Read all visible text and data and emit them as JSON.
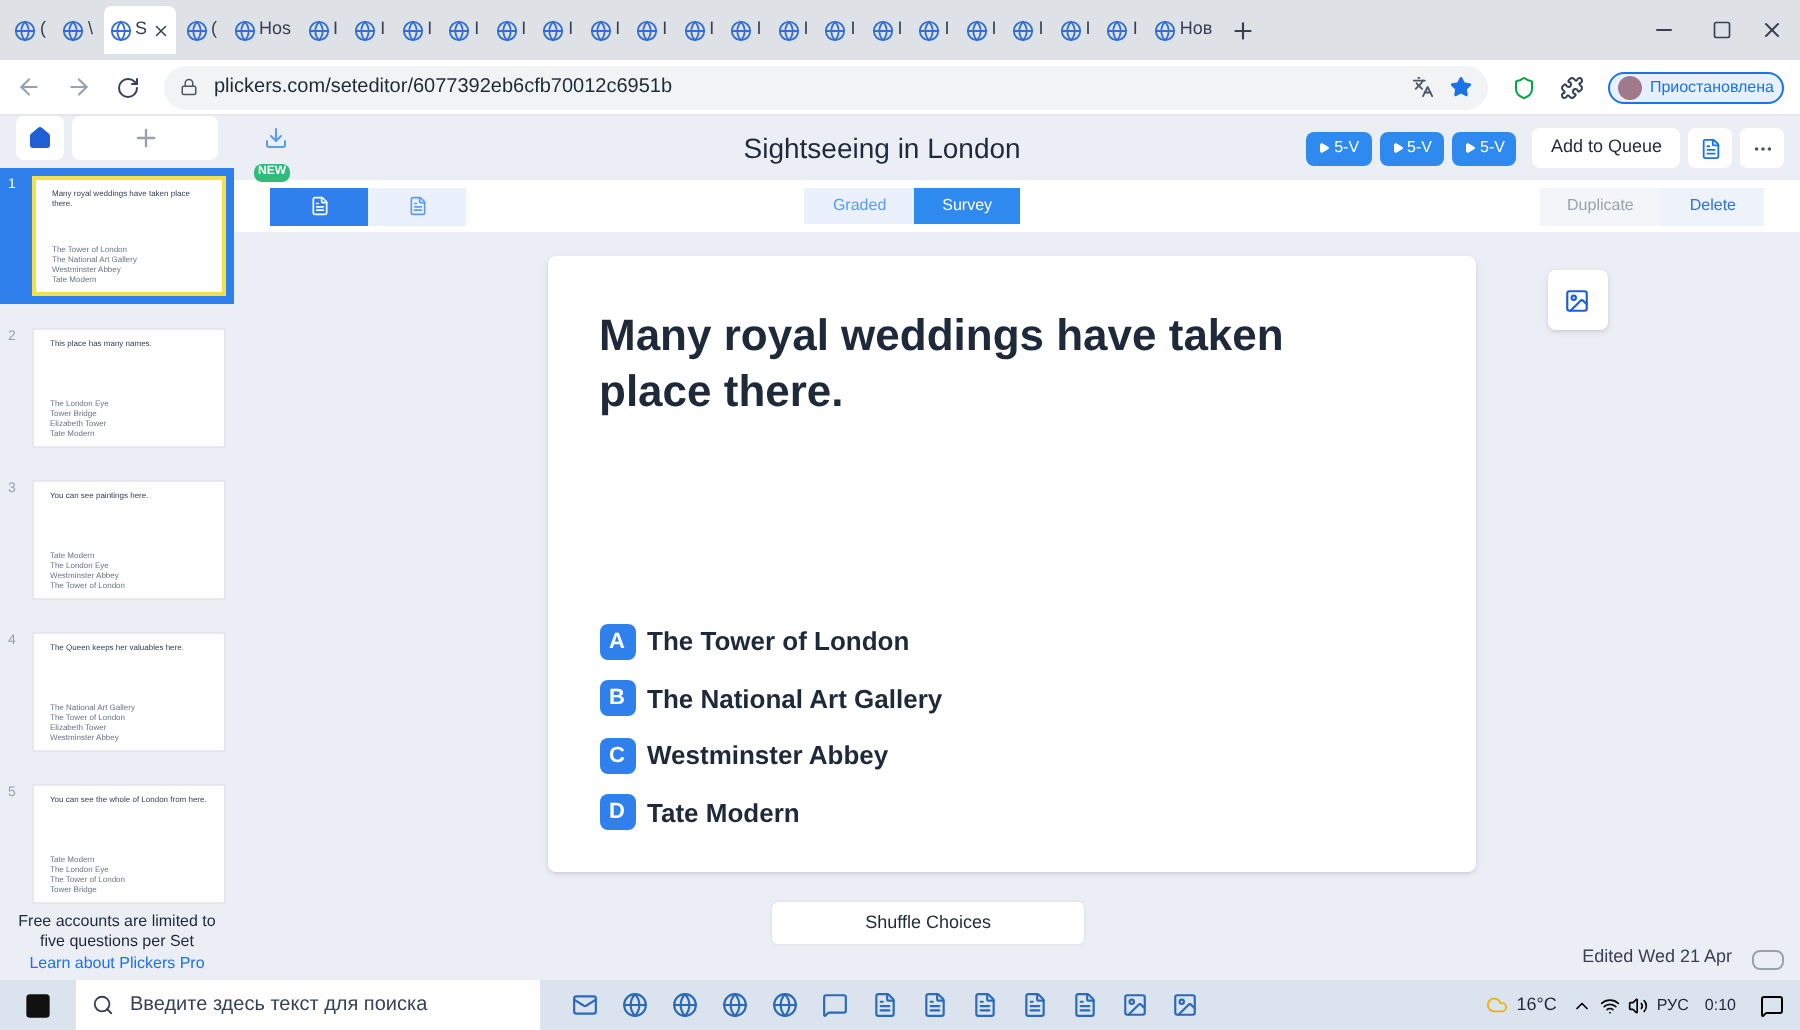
{
  "browser": {
    "tabs": [
      {
        "label": "(",
        "selected": false
      },
      {
        "label": "\\",
        "selected": false
      },
      {
        "label": "S",
        "selected": true
      },
      {
        "label": "(",
        "selected": false
      },
      {
        "label": "Hos",
        "selected": false
      },
      {
        "label": "I",
        "selected": false
      },
      {
        "label": "I",
        "selected": false
      },
      {
        "label": "I",
        "selected": false
      },
      {
        "label": "I",
        "selected": false
      },
      {
        "label": "I",
        "selected": false
      },
      {
        "label": "I",
        "selected": false
      },
      {
        "label": "I",
        "selected": false
      },
      {
        "label": "I",
        "selected": false
      },
      {
        "label": "I",
        "selected": false
      },
      {
        "label": "I",
        "selected": false
      },
      {
        "label": "I",
        "selected": false
      },
      {
        "label": "I",
        "selected": false
      },
      {
        "label": "I",
        "selected": false
      },
      {
        "label": "I",
        "selected": false
      },
      {
        "label": "I",
        "selected": false
      },
      {
        "label": "I",
        "selected": false
      },
      {
        "label": "I",
        "selected": false
      },
      {
        "label": "I",
        "selected": false
      },
      {
        "label": "Нов",
        "selected": false
      }
    ],
    "url": "plickers.com/seteditor/6077392eb6cfb70012c6951b",
    "profile": "Приостановлена"
  },
  "app": {
    "title": "Sightseeing in London",
    "new_badge": "NEW",
    "play_buttons": [
      "5-V",
      "5-V",
      "5-V"
    ],
    "add_to_queue": "Add to Queue",
    "question_types": [
      {
        "label": "Graded",
        "selected": false
      },
      {
        "label": "Survey",
        "selected": true
      }
    ],
    "layout_tabs": [
      {
        "selected": true
      },
      {
        "selected": false
      }
    ],
    "actions": [
      {
        "label": "Duplicate",
        "disabled": true
      },
      {
        "label": "Delete",
        "disabled": false
      }
    ],
    "slides": [
      {
        "number": "1",
        "selected": true,
        "question": "Many royal weddings have taken place there.",
        "choices": [
          "The Tower of London",
          "The National Art Gallery",
          "Westminster Abbey",
          "Tate Modern"
        ]
      },
      {
        "number": "2",
        "selected": false,
        "question": "This place has many names.",
        "choices": [
          "The London Eye",
          "Tower Bridge",
          "Elizabeth Tower",
          "Tate Modern"
        ]
      },
      {
        "number": "3",
        "selected": false,
        "question": "You can see paintings here.",
        "choices": [
          "Tate Modern",
          "The London Eye",
          "Westminster Abbey",
          "The Tower of London"
        ]
      },
      {
        "number": "4",
        "selected": false,
        "question": "The Queen keeps her valuables here.",
        "choices": [
          "The National Art Gallery",
          "The Tower of London",
          "Elizabeth Tower",
          "Westminster Abbey"
        ]
      },
      {
        "number": "5",
        "selected": false,
        "question": "You can see the whole of London from here.",
        "choices": [
          "Tate Modern",
          "The London Eye",
          "The Tower of London",
          "Tower Bridge"
        ]
      }
    ],
    "limit_note": "Free accounts are limited to five questions per Set",
    "pro_link": "Learn about Plickers Pro",
    "question": "Many royal weddings have taken place there.",
    "choices": [
      {
        "letter": "A",
        "text": "The Tower of London"
      },
      {
        "letter": "B",
        "text": "The National Art Gallery"
      },
      {
        "letter": "C",
        "text": "Westminster Abbey"
      },
      {
        "letter": "D",
        "text": "Tate Modern"
      }
    ],
    "shuffle": "Shuffle Choices",
    "edited": "Edited Wed 21 Apr"
  },
  "taskbar": {
    "search_placeholder": "Введите здесь текст для поиска",
    "temperature": "16°C",
    "language": "РУС",
    "time": "0:10"
  }
}
